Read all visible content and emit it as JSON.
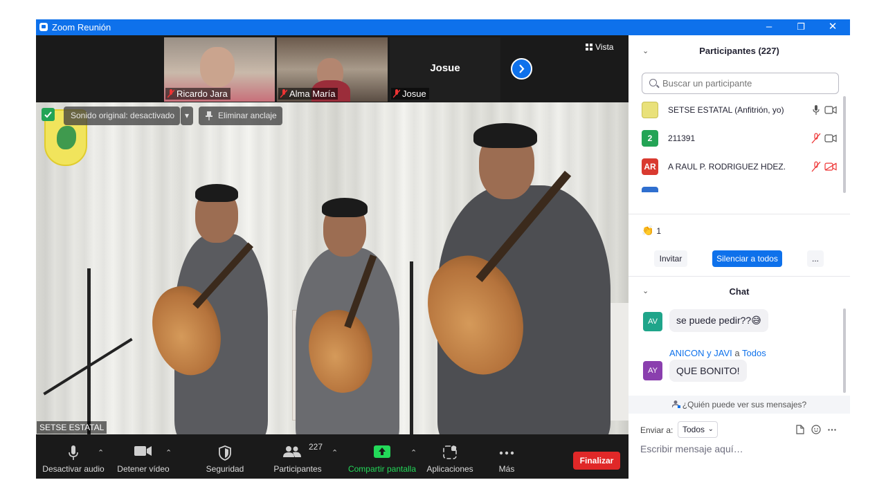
{
  "window": {
    "title": "Zoom Reunión",
    "controls": [
      "–",
      "❐",
      "✕"
    ]
  },
  "gallery": {
    "thumbnails": [
      {
        "name": "Ricardo Jara",
        "muted": true
      },
      {
        "name": "Alma María",
        "muted": true
      },
      {
        "name": "Josue",
        "muted": true,
        "display_name": "Josue"
      }
    ],
    "view_label": "Vista"
  },
  "main_video": {
    "original_sound_label": "Sonido original: desactivado",
    "unpin_label": "Eliminar anclaje",
    "speaker_name": "SETSE ESTATAL"
  },
  "toolbar": {
    "items": [
      {
        "label": "Desactivar audio"
      },
      {
        "label": "Detener vídeo"
      },
      {
        "label": "Seguridad"
      },
      {
        "label": "Participantes",
        "count": "227"
      },
      {
        "label": "Compartir pantalla"
      },
      {
        "label": "Aplicaciones"
      },
      {
        "label": "Más"
      }
    ],
    "end_label": "Finalizar"
  },
  "participants_panel": {
    "title": "Participantes (227)",
    "search_placeholder": "Buscar un participante",
    "list": [
      {
        "initials": "",
        "name": "SETSE ESTATAL (Anfitrión, yo)",
        "color": "#e9e17a"
      },
      {
        "initials": "2",
        "name": "211391",
        "color": "#23a455"
      },
      {
        "initials": "AR",
        "name": "A RAUL P. RODRIGUEZ HDEZ.",
        "color": "#d93a30"
      },
      {
        "initials": "",
        "name": "",
        "color": "#2f6fcf"
      }
    ],
    "reaction": {
      "emoji": "👏",
      "count": "1"
    },
    "invite_label": "Invitar",
    "mute_all_label": "Silenciar a todos",
    "more_label": "..."
  },
  "chat_panel": {
    "title": "Chat",
    "messages": [
      {
        "initials": "AV",
        "color": "#1fa58a",
        "text": "se puede pedir??",
        "emoji": "😅"
      },
      {
        "initials": "AY",
        "color": "#8a3fae",
        "sender": "ANICON y JAVI",
        "to_word": "a",
        "to": "Todos",
        "text": "QUE BONITO!"
      }
    ],
    "privacy_text": "¿Quién puede ver sus mensajes?",
    "send_to_label": "Enviar a:",
    "send_to_value": "Todos",
    "compose_placeholder": "Escribir mensaje aquí…"
  },
  "colors": {
    "zoom_blue": "#0e71eb",
    "end_red": "#e02828",
    "share_green": "#23d959"
  }
}
